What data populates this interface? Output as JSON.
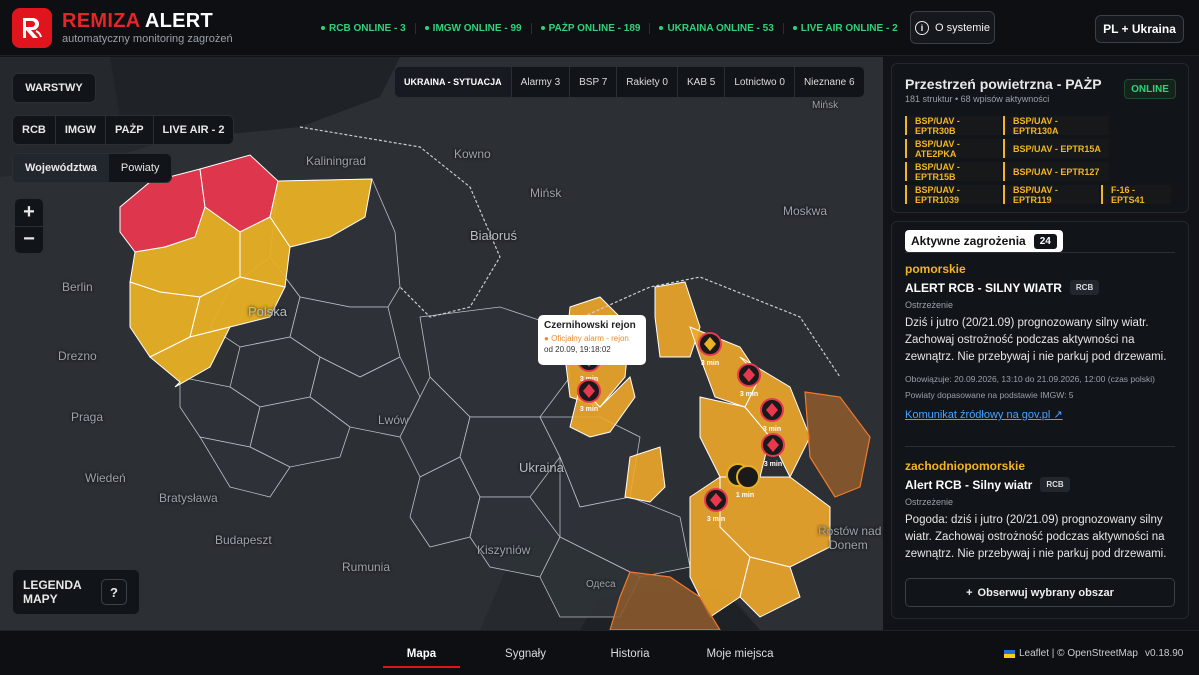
{
  "header": {
    "brand_part1": "REMIZA",
    "brand_part2": "ALERT",
    "tagline": "automatyczny monitoring zagrożeń",
    "statuses": [
      "RCB ONLINE - 3",
      "IMGW ONLINE - 99",
      "PAŻP ONLINE - 189",
      "UKRAINA ONLINE - 53",
      "LIVE AIR ONLINE - 2"
    ],
    "about_label": "O systemie",
    "lang_label": "PL + Ukraina"
  },
  "map": {
    "layers_label": "WARSTWY",
    "layer_tabs": [
      "RCB",
      "IMGW",
      "PAŻP",
      "LIVE AIR - 2"
    ],
    "region_tabs": [
      "Województwa",
      "Powiaty"
    ],
    "zoom_in": "+",
    "zoom_out": "−",
    "situation_tabs": [
      "UKRAINA - SYTUACJA",
      "Alarmy 3",
      "BSP 7",
      "Rakiety 0",
      "KAB 5",
      "Lotnictwo 0",
      "Nieznane 6"
    ],
    "labels": {
      "kaliningrad": "Kaliningrad",
      "kowno": "Kowno",
      "minsk": "Mińsk",
      "moskwa": "Moskwa",
      "bialorus": "Białoruś",
      "berlin": "Berlin",
      "polska": "Polska",
      "drezno": "Drezno",
      "praga": "Praga",
      "lwow": "Lwów",
      "ukraina": "Ukraina",
      "wieden": "Wiedeń",
      "bratyslawa": "Bratysława",
      "budapeszt": "Budapeszt",
      "kiszyniow": "Kiszyniów",
      "rumunia": "Rumunia",
      "odessa": "Одеса",
      "rostow1": "Rostów nad",
      "rostow2": "Donem",
      "minsk_small": "Mińsk"
    },
    "popup": {
      "title": "Czernihowski rejon",
      "alarm": "Oficjalny alarm - rejon",
      "date": "od 20.09, 19:18:02"
    },
    "marker_time": "3 min",
    "marker_time_alt": "1 min",
    "legend_label": "LEGENDA MAPY",
    "legend_q": "?"
  },
  "airspace": {
    "title": "Przestrzeń powietrzna - PAŻP",
    "subtitle": "181 struktur • 68 wpisów aktywności",
    "online": "ONLINE",
    "chips": [
      "BSP/UAV - EPTR30B",
      "BSP/UAV - EPTR130A",
      "BSP/UAV - ATE2PKA",
      "BSP/UAV - EPTR15A",
      "BSP/UAV - EPTR15B",
      "BSP/UAV - EPTR127",
      "BSP/UAV - EPTR1039",
      "BSP/UAV - EPTR119",
      "F-16 - EPTS41"
    ]
  },
  "threats": {
    "title": "Aktywne zagrożenia",
    "count": "24",
    "alerts": [
      {
        "region": "pomorskie",
        "title": "ALERT RCB - SILNY WIATR",
        "badge": "RCB",
        "type": "Ostrzeżenie",
        "desc": "Dziś i jutro (20/21.09) prognozowany silny wiatr. Zachowaj ostrożność podczas aktywności na zewnątrz. Nie przebywaj i nie parkuj pod drzewami.",
        "valid": "Obowiązuje: 20.09.2026, 13:10 do 21.09.2026, 12:00 (czas polski)",
        "basis": "Powiaty dopasowane na podstawie IMGW: 5",
        "link": "Komunikat źródłowy na gov.pl ↗"
      },
      {
        "region": "zachodniopomorskie",
        "title": "Alert RCB - Silny wiatr",
        "badge": "RCB",
        "type": "Ostrzeżenie",
        "desc": "Pogoda: dziś i jutro (20/21.09) prognozowany silny wiatr. Zachowaj ostrożność podczas aktywności na zewnątrz. Nie przebywaj i nie parkuj pod drzewami."
      }
    ],
    "observe_label": "Obserwuj wybrany obszar"
  },
  "bottom": {
    "nav": [
      "Mapa",
      "Sygnały",
      "Historia",
      "Moje miejsca"
    ],
    "attribution": "Leaflet | © OpenStreetMap",
    "version": "v0.18.90"
  },
  "colors": {
    "brand_red": "#e0141c",
    "alert_red": "#e8384f",
    "warn_yellow": "#e8b024",
    "online_green": "#2fd27a",
    "ukraine_orange": "#f0a92a",
    "russia_brown": "#8a5a2e"
  }
}
